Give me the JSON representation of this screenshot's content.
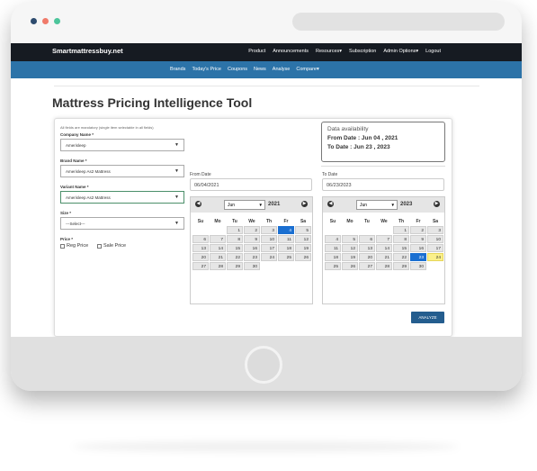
{
  "site": {
    "brand": "Smartmattressbuy.net",
    "top_menu": [
      "Product",
      "Announcements",
      "Resources▾",
      "Subscription",
      "Admin Options▾",
      "Logout"
    ],
    "sub_menu": [
      "Brands",
      "Today's Price",
      "Coupons",
      "News",
      "Analyse",
      "Compare▾"
    ]
  },
  "page": {
    "title": "Mattress Pricing Intelligence Tool",
    "note": "All fields are mandatory (single item selectable in all fields)"
  },
  "form": {
    "company_label": "Company Name *",
    "company_value": "Amerisleep",
    "brand_label": "Brand Name *",
    "brand_value": "Amerisleep As2 Mattress",
    "variant_label": "Variant Name *",
    "variant_value": "Amerisleep As2 Mattress",
    "size_label": "Size *",
    "size_value": "---Select---",
    "price_label": "Price *",
    "reg_price": "Reg Price",
    "sale_price": "Sale Price",
    "analyze": "ANALYZE"
  },
  "availability": {
    "heading": "Data availability",
    "from": "From Date : Jun 04 , 2021",
    "to": "To Date : Jun 23 , 2023"
  },
  "from_cal": {
    "label": "From Date",
    "value": "06/04/2021",
    "month": "Jun",
    "year": "2021",
    "weekdays": [
      "Su",
      "Mo",
      "Tu",
      "We",
      "Th",
      "Fr",
      "Sa"
    ],
    "lead_blanks": 2,
    "days": 30,
    "selected": 4,
    "today": 0
  },
  "to_cal": {
    "label": "To Date",
    "value": "06/23/2023",
    "month": "Jun",
    "year": "2023",
    "weekdays": [
      "Su",
      "Mo",
      "Tu",
      "We",
      "Th",
      "Fr",
      "Sa"
    ],
    "lead_blanks": 4,
    "days": 30,
    "selected": 23,
    "today": 24
  },
  "colors": {
    "topnav": "#161b22",
    "subnav": "#2c73a8",
    "selected_day": "#1a6fd1",
    "today_day": "#fbf08a",
    "analyze_button": "#245d8e"
  }
}
